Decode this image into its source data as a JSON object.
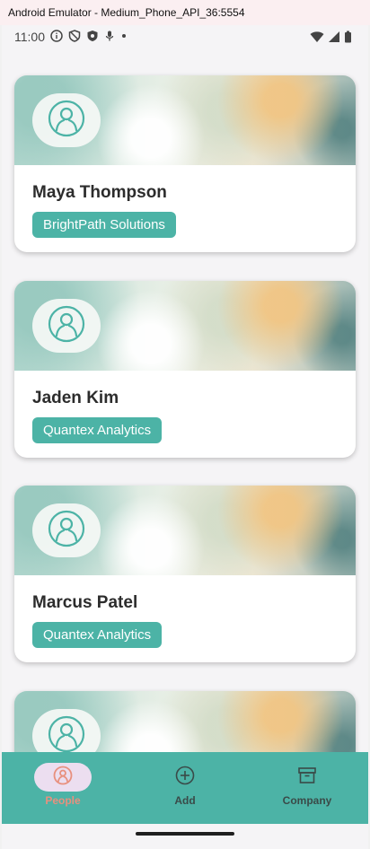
{
  "window": {
    "title": "Android Emulator - Medium_Phone_API_36:5554"
  },
  "status_bar": {
    "time": "11:00",
    "left_icons": [
      "info-icon",
      "shield-icon",
      "shield-filled-icon",
      "mic-icon",
      "dot-icon"
    ],
    "right_icons": [
      "wifi-icon",
      "signal-icon",
      "battery-icon"
    ]
  },
  "contacts": [
    {
      "name": "Maya Thompson",
      "company": "BrightPath Solutions"
    },
    {
      "name": "Jaden Kim",
      "company": "Quantex Analytics"
    },
    {
      "name": "Marcus Patel",
      "company": "Quantex Analytics"
    },
    {
      "name": "",
      "company": ""
    }
  ],
  "bottom_nav": {
    "items": [
      {
        "label": "People",
        "icon": "people-icon",
        "active": true
      },
      {
        "label": "Add",
        "icon": "add-circle-icon",
        "active": false
      },
      {
        "label": "Company",
        "icon": "archive-box-icon",
        "active": false
      }
    ]
  },
  "colors": {
    "accent": "#4cb3a6",
    "active_nav_label": "#e8907e",
    "active_nav_pill": "#ecdef0",
    "card_background": "#ffffff",
    "screen_background": "#f5f4f6"
  }
}
